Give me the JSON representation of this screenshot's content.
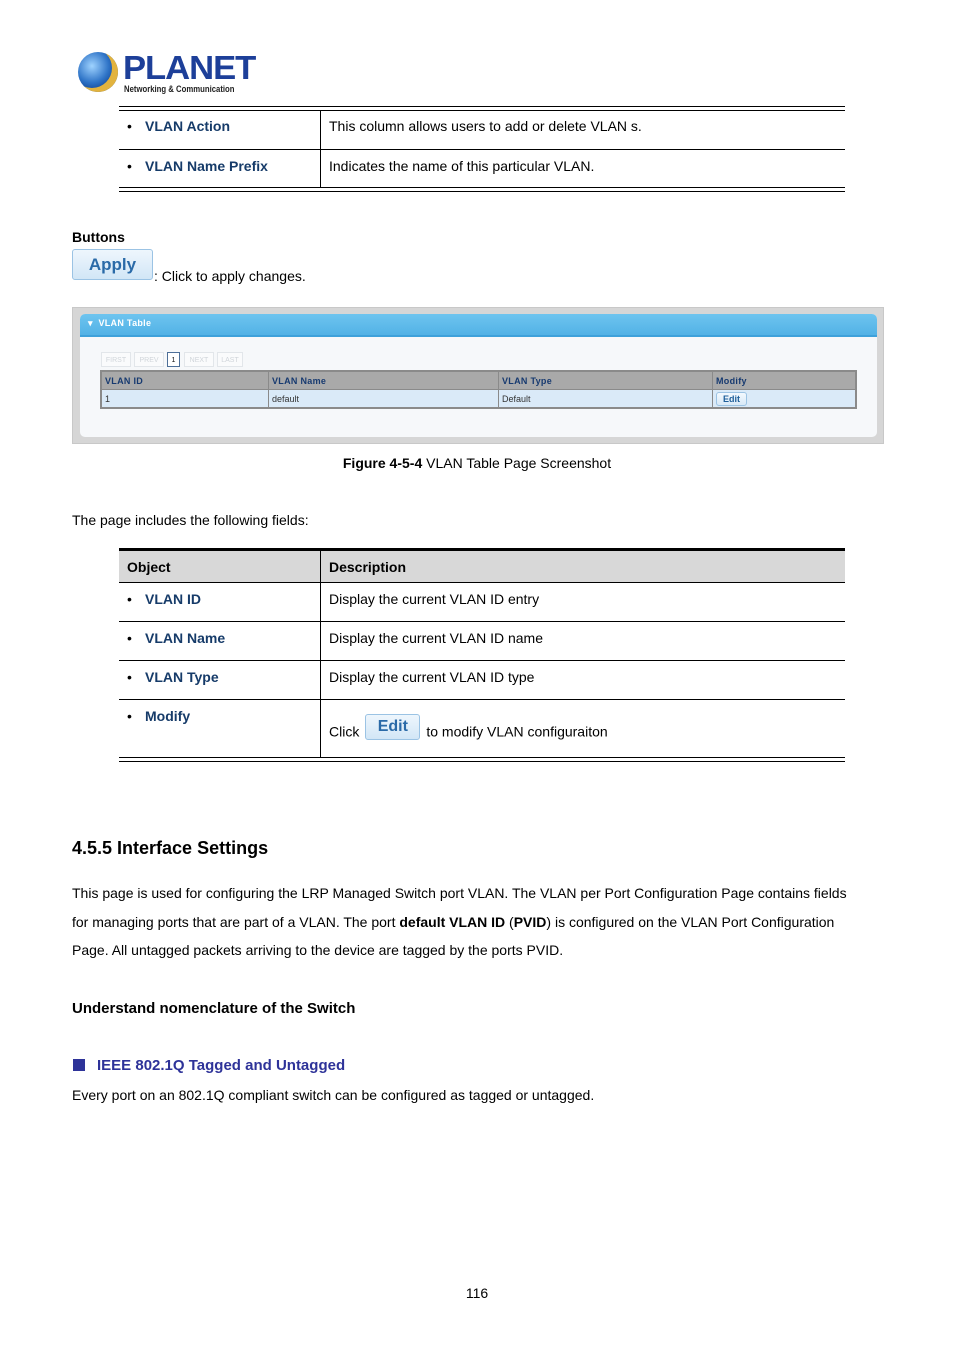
{
  "header": {
    "logo_brand": "PLANET",
    "logo_tagline": "Networking & Communication"
  },
  "top_table": {
    "rows": [
      {
        "object": "VLAN Action",
        "description": "This column allows users to add or delete VLAN s."
      },
      {
        "object": "VLAN Name Prefix",
        "description": "Indicates the name of this particular VLAN."
      }
    ]
  },
  "buttons_section": {
    "heading": "Buttons",
    "apply_label": "Apply",
    "apply_desc": ": Click to apply changes."
  },
  "figure": {
    "panel_title": "VLAN Table",
    "pagination": [
      "FIRST",
      "PREV",
      "1",
      "NEXT",
      "LAST"
    ],
    "current_page": "1",
    "columns": [
      "VLAN ID",
      "VLAN Name",
      "VLAN Type",
      "Modify"
    ],
    "rows": [
      {
        "vlan_id": "1",
        "vlan_name": "default",
        "vlan_type": "Default",
        "modify": "Edit"
      }
    ],
    "caption_bold": "Figure 4-5-4",
    "caption_text": " VLAN Table Page Screenshot"
  },
  "fields_intro": "The page includes the following fields:",
  "fields_table": {
    "header": {
      "object": "Object",
      "description": "Description"
    },
    "rows": [
      {
        "object": "VLAN ID",
        "description": "Display the current VLAN ID entry"
      },
      {
        "object": "VLAN Name",
        "description": "Display the current VLAN ID name"
      },
      {
        "object": "VLAN Type",
        "description": "Display the current VLAN ID type"
      },
      {
        "object": "Modify",
        "description_prefix": "Click",
        "button_label": "Edit",
        "description_suffix": "to modify VLAN configuraiton"
      }
    ]
  },
  "section": {
    "title": "4.5.5 Interface Settings",
    "para_part1": "This page is used for configuring the LRP Managed Switch port VLAN. The VLAN per Port Configuration Page contains fields",
    "para_part2a": "for managing ports that are part of a VLAN. The port ",
    "para_bold1": "default VLAN ID",
    "para_part2b": " (",
    "para_bold2": "PVID",
    "para_part2c": ") is configured on the VLAN Port Configuration",
    "para_part3": "Page. All untagged packets arriving to the device are tagged by the ports PVID.",
    "nomenclature_heading": "Understand nomenclature of the Switch",
    "subheading": "IEEE 802.1Q Tagged and Untagged",
    "sub_para": "Every port on an 802.1Q compliant switch can be configured as tagged or untagged."
  },
  "footer": {
    "page_number": "116"
  }
}
